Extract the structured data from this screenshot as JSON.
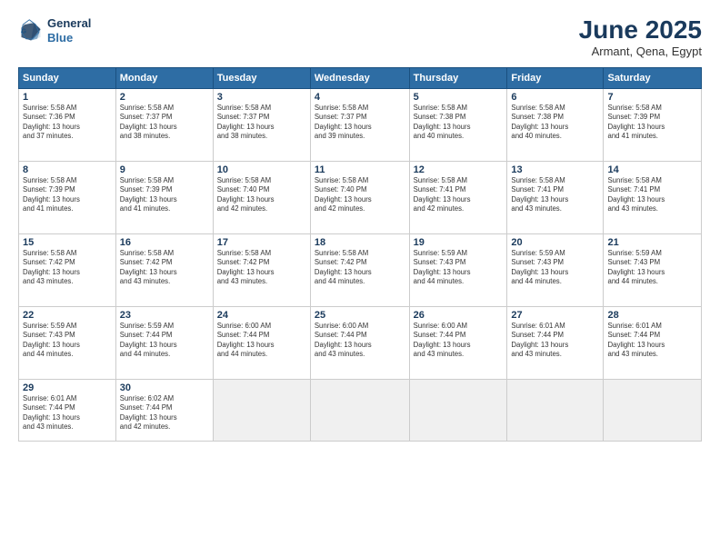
{
  "logo": {
    "line1": "General",
    "line2": "Blue"
  },
  "title": "June 2025",
  "subtitle": "Armant, Qena, Egypt",
  "days_of_week": [
    "Sunday",
    "Monday",
    "Tuesday",
    "Wednesday",
    "Thursday",
    "Friday",
    "Saturday"
  ],
  "weeks": [
    [
      {
        "day": 1,
        "info": "Sunrise: 5:58 AM\nSunset: 7:36 PM\nDaylight: 13 hours\nand 37 minutes."
      },
      {
        "day": 2,
        "info": "Sunrise: 5:58 AM\nSunset: 7:37 PM\nDaylight: 13 hours\nand 38 minutes."
      },
      {
        "day": 3,
        "info": "Sunrise: 5:58 AM\nSunset: 7:37 PM\nDaylight: 13 hours\nand 38 minutes."
      },
      {
        "day": 4,
        "info": "Sunrise: 5:58 AM\nSunset: 7:37 PM\nDaylight: 13 hours\nand 39 minutes."
      },
      {
        "day": 5,
        "info": "Sunrise: 5:58 AM\nSunset: 7:38 PM\nDaylight: 13 hours\nand 40 minutes."
      },
      {
        "day": 6,
        "info": "Sunrise: 5:58 AM\nSunset: 7:38 PM\nDaylight: 13 hours\nand 40 minutes."
      },
      {
        "day": 7,
        "info": "Sunrise: 5:58 AM\nSunset: 7:39 PM\nDaylight: 13 hours\nand 41 minutes."
      }
    ],
    [
      {
        "day": 8,
        "info": "Sunrise: 5:58 AM\nSunset: 7:39 PM\nDaylight: 13 hours\nand 41 minutes."
      },
      {
        "day": 9,
        "info": "Sunrise: 5:58 AM\nSunset: 7:39 PM\nDaylight: 13 hours\nand 41 minutes."
      },
      {
        "day": 10,
        "info": "Sunrise: 5:58 AM\nSunset: 7:40 PM\nDaylight: 13 hours\nand 42 minutes."
      },
      {
        "day": 11,
        "info": "Sunrise: 5:58 AM\nSunset: 7:40 PM\nDaylight: 13 hours\nand 42 minutes."
      },
      {
        "day": 12,
        "info": "Sunrise: 5:58 AM\nSunset: 7:41 PM\nDaylight: 13 hours\nand 42 minutes."
      },
      {
        "day": 13,
        "info": "Sunrise: 5:58 AM\nSunset: 7:41 PM\nDaylight: 13 hours\nand 43 minutes."
      },
      {
        "day": 14,
        "info": "Sunrise: 5:58 AM\nSunset: 7:41 PM\nDaylight: 13 hours\nand 43 minutes."
      }
    ],
    [
      {
        "day": 15,
        "info": "Sunrise: 5:58 AM\nSunset: 7:42 PM\nDaylight: 13 hours\nand 43 minutes."
      },
      {
        "day": 16,
        "info": "Sunrise: 5:58 AM\nSunset: 7:42 PM\nDaylight: 13 hours\nand 43 minutes."
      },
      {
        "day": 17,
        "info": "Sunrise: 5:58 AM\nSunset: 7:42 PM\nDaylight: 13 hours\nand 43 minutes."
      },
      {
        "day": 18,
        "info": "Sunrise: 5:58 AM\nSunset: 7:42 PM\nDaylight: 13 hours\nand 44 minutes."
      },
      {
        "day": 19,
        "info": "Sunrise: 5:59 AM\nSunset: 7:43 PM\nDaylight: 13 hours\nand 44 minutes."
      },
      {
        "day": 20,
        "info": "Sunrise: 5:59 AM\nSunset: 7:43 PM\nDaylight: 13 hours\nand 44 minutes."
      },
      {
        "day": 21,
        "info": "Sunrise: 5:59 AM\nSunset: 7:43 PM\nDaylight: 13 hours\nand 44 minutes."
      }
    ],
    [
      {
        "day": 22,
        "info": "Sunrise: 5:59 AM\nSunset: 7:43 PM\nDaylight: 13 hours\nand 44 minutes."
      },
      {
        "day": 23,
        "info": "Sunrise: 5:59 AM\nSunset: 7:44 PM\nDaylight: 13 hours\nand 44 minutes."
      },
      {
        "day": 24,
        "info": "Sunrise: 6:00 AM\nSunset: 7:44 PM\nDaylight: 13 hours\nand 44 minutes."
      },
      {
        "day": 25,
        "info": "Sunrise: 6:00 AM\nSunset: 7:44 PM\nDaylight: 13 hours\nand 43 minutes."
      },
      {
        "day": 26,
        "info": "Sunrise: 6:00 AM\nSunset: 7:44 PM\nDaylight: 13 hours\nand 43 minutes."
      },
      {
        "day": 27,
        "info": "Sunrise: 6:01 AM\nSunset: 7:44 PM\nDaylight: 13 hours\nand 43 minutes."
      },
      {
        "day": 28,
        "info": "Sunrise: 6:01 AM\nSunset: 7:44 PM\nDaylight: 13 hours\nand 43 minutes."
      }
    ],
    [
      {
        "day": 29,
        "info": "Sunrise: 6:01 AM\nSunset: 7:44 PM\nDaylight: 13 hours\nand 43 minutes."
      },
      {
        "day": 30,
        "info": "Sunrise: 6:02 AM\nSunset: 7:44 PM\nDaylight: 13 hours\nand 42 minutes."
      },
      null,
      null,
      null,
      null,
      null
    ]
  ]
}
